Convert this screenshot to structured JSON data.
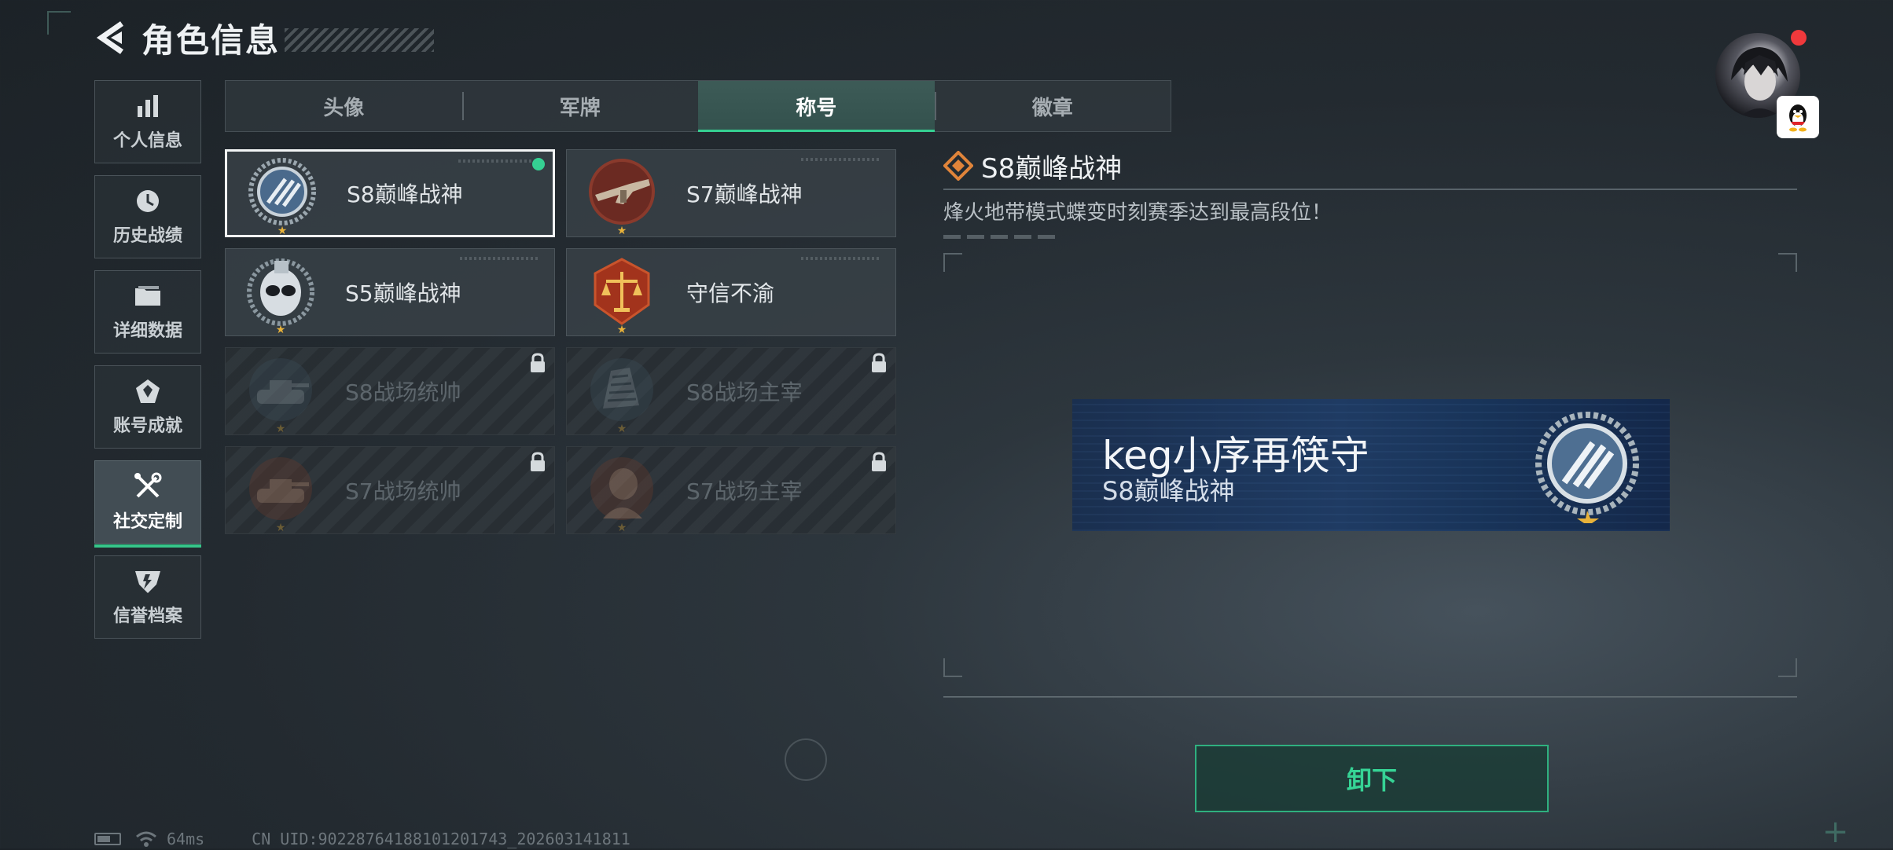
{
  "header": {
    "title": "角色信息"
  },
  "sidebar": {
    "items": [
      {
        "label": "个人信息",
        "icon": "bar-chart-icon",
        "active": false
      },
      {
        "label": "历史战绩",
        "icon": "clock-icon",
        "active": false
      },
      {
        "label": "详细数据",
        "icon": "folder-icon",
        "active": false
      },
      {
        "label": "账号成就",
        "icon": "achievement-icon",
        "active": false
      },
      {
        "label": "社交定制",
        "icon": "wrench-icon",
        "active": true
      },
      {
        "label": "信誉档案",
        "icon": "shield-icon",
        "active": false
      }
    ]
  },
  "tabs": [
    {
      "label": "头像",
      "active": false
    },
    {
      "label": "军牌",
      "active": false
    },
    {
      "label": "称号",
      "active": true
    },
    {
      "label": "徽章",
      "active": false
    }
  ],
  "titles": [
    {
      "name": "S8巅峰战神",
      "locked": false,
      "selected": true,
      "equipped": true,
      "emblem": "s8-peak-emblem"
    },
    {
      "name": "S7巅峰战神",
      "locked": false,
      "selected": false,
      "equipped": false,
      "emblem": "s7-peak-emblem"
    },
    {
      "name": "S5巅峰战神",
      "locked": false,
      "selected": false,
      "equipped": false,
      "emblem": "s5-peak-emblem"
    },
    {
      "name": "守信不渝",
      "locked": false,
      "selected": false,
      "equipped": false,
      "emblem": "scales-emblem"
    },
    {
      "name": "S8战场统帅",
      "locked": true,
      "selected": false,
      "equipped": false,
      "emblem": "tank-emblem"
    },
    {
      "name": "S8战场主宰",
      "locked": true,
      "selected": false,
      "equipped": false,
      "emblem": "city-emblem"
    },
    {
      "name": "S7战场统帅",
      "locked": true,
      "selected": false,
      "equipped": false,
      "emblem": "tank-emblem"
    },
    {
      "name": "S7战场主宰",
      "locked": true,
      "selected": false,
      "equipped": false,
      "emblem": "soldier-emblem"
    }
  ],
  "detail": {
    "title": "S8巅峰战神",
    "description": "烽火地带模式蝶变时刻赛季达到最高段位！"
  },
  "nameplate": {
    "player_name": "keg小序再筷守",
    "title": "S8巅峰战神"
  },
  "actions": {
    "unequip_label": "卸下"
  },
  "status_bar": {
    "ping": "64ms",
    "uid": "CN UID:9022876418810120174З_202603141811"
  },
  "colors": {
    "accent": "#36d495",
    "notification": "#f0393c",
    "star": "#e8b23a"
  }
}
